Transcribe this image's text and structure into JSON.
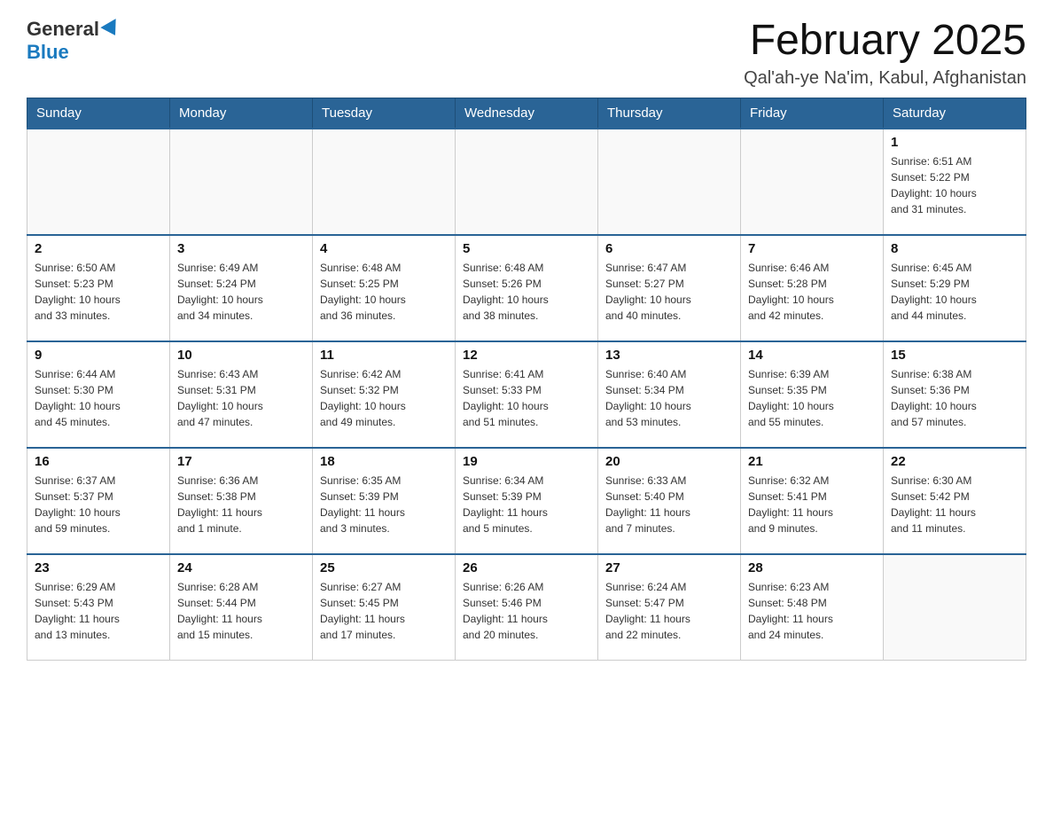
{
  "header": {
    "logo_general": "General",
    "logo_blue": "Blue",
    "main_title": "February 2025",
    "subtitle": "Qal'ah-ye Na'im, Kabul, Afghanistan"
  },
  "calendar": {
    "days_of_week": [
      "Sunday",
      "Monday",
      "Tuesday",
      "Wednesday",
      "Thursday",
      "Friday",
      "Saturday"
    ],
    "weeks": [
      [
        {
          "day": "",
          "info": ""
        },
        {
          "day": "",
          "info": ""
        },
        {
          "day": "",
          "info": ""
        },
        {
          "day": "",
          "info": ""
        },
        {
          "day": "",
          "info": ""
        },
        {
          "day": "",
          "info": ""
        },
        {
          "day": "1",
          "info": "Sunrise: 6:51 AM\nSunset: 5:22 PM\nDaylight: 10 hours\nand 31 minutes."
        }
      ],
      [
        {
          "day": "2",
          "info": "Sunrise: 6:50 AM\nSunset: 5:23 PM\nDaylight: 10 hours\nand 33 minutes."
        },
        {
          "day": "3",
          "info": "Sunrise: 6:49 AM\nSunset: 5:24 PM\nDaylight: 10 hours\nand 34 minutes."
        },
        {
          "day": "4",
          "info": "Sunrise: 6:48 AM\nSunset: 5:25 PM\nDaylight: 10 hours\nand 36 minutes."
        },
        {
          "day": "5",
          "info": "Sunrise: 6:48 AM\nSunset: 5:26 PM\nDaylight: 10 hours\nand 38 minutes."
        },
        {
          "day": "6",
          "info": "Sunrise: 6:47 AM\nSunset: 5:27 PM\nDaylight: 10 hours\nand 40 minutes."
        },
        {
          "day": "7",
          "info": "Sunrise: 6:46 AM\nSunset: 5:28 PM\nDaylight: 10 hours\nand 42 minutes."
        },
        {
          "day": "8",
          "info": "Sunrise: 6:45 AM\nSunset: 5:29 PM\nDaylight: 10 hours\nand 44 minutes."
        }
      ],
      [
        {
          "day": "9",
          "info": "Sunrise: 6:44 AM\nSunset: 5:30 PM\nDaylight: 10 hours\nand 45 minutes."
        },
        {
          "day": "10",
          "info": "Sunrise: 6:43 AM\nSunset: 5:31 PM\nDaylight: 10 hours\nand 47 minutes."
        },
        {
          "day": "11",
          "info": "Sunrise: 6:42 AM\nSunset: 5:32 PM\nDaylight: 10 hours\nand 49 minutes."
        },
        {
          "day": "12",
          "info": "Sunrise: 6:41 AM\nSunset: 5:33 PM\nDaylight: 10 hours\nand 51 minutes."
        },
        {
          "day": "13",
          "info": "Sunrise: 6:40 AM\nSunset: 5:34 PM\nDaylight: 10 hours\nand 53 minutes."
        },
        {
          "day": "14",
          "info": "Sunrise: 6:39 AM\nSunset: 5:35 PM\nDaylight: 10 hours\nand 55 minutes."
        },
        {
          "day": "15",
          "info": "Sunrise: 6:38 AM\nSunset: 5:36 PM\nDaylight: 10 hours\nand 57 minutes."
        }
      ],
      [
        {
          "day": "16",
          "info": "Sunrise: 6:37 AM\nSunset: 5:37 PM\nDaylight: 10 hours\nand 59 minutes."
        },
        {
          "day": "17",
          "info": "Sunrise: 6:36 AM\nSunset: 5:38 PM\nDaylight: 11 hours\nand 1 minute."
        },
        {
          "day": "18",
          "info": "Sunrise: 6:35 AM\nSunset: 5:39 PM\nDaylight: 11 hours\nand 3 minutes."
        },
        {
          "day": "19",
          "info": "Sunrise: 6:34 AM\nSunset: 5:39 PM\nDaylight: 11 hours\nand 5 minutes."
        },
        {
          "day": "20",
          "info": "Sunrise: 6:33 AM\nSunset: 5:40 PM\nDaylight: 11 hours\nand 7 minutes."
        },
        {
          "day": "21",
          "info": "Sunrise: 6:32 AM\nSunset: 5:41 PM\nDaylight: 11 hours\nand 9 minutes."
        },
        {
          "day": "22",
          "info": "Sunrise: 6:30 AM\nSunset: 5:42 PM\nDaylight: 11 hours\nand 11 minutes."
        }
      ],
      [
        {
          "day": "23",
          "info": "Sunrise: 6:29 AM\nSunset: 5:43 PM\nDaylight: 11 hours\nand 13 minutes."
        },
        {
          "day": "24",
          "info": "Sunrise: 6:28 AM\nSunset: 5:44 PM\nDaylight: 11 hours\nand 15 minutes."
        },
        {
          "day": "25",
          "info": "Sunrise: 6:27 AM\nSunset: 5:45 PM\nDaylight: 11 hours\nand 17 minutes."
        },
        {
          "day": "26",
          "info": "Sunrise: 6:26 AM\nSunset: 5:46 PM\nDaylight: 11 hours\nand 20 minutes."
        },
        {
          "day": "27",
          "info": "Sunrise: 6:24 AM\nSunset: 5:47 PM\nDaylight: 11 hours\nand 22 minutes."
        },
        {
          "day": "28",
          "info": "Sunrise: 6:23 AM\nSunset: 5:48 PM\nDaylight: 11 hours\nand 24 minutes."
        },
        {
          "day": "",
          "info": ""
        }
      ]
    ]
  }
}
